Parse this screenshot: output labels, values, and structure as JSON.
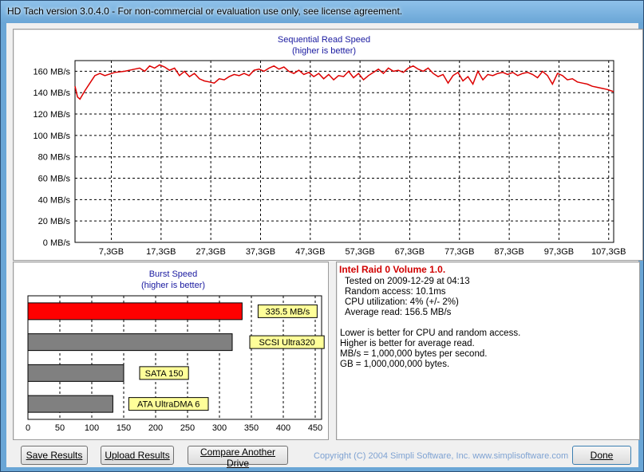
{
  "window": {
    "title": "HD Tach version 3.0.4.0  - For non-commercial or evaluation use only, see license agreement."
  },
  "sequential": {
    "title": "Sequential Read Speed",
    "subtitle": "(higher is better)",
    "y_ticks": [
      "0 MB/s",
      "20 MB/s",
      "40 MB/s",
      "60 MB/s",
      "80 MB/s",
      "100 MB/s",
      "120 MB/s",
      "140 MB/s",
      "160 MB/s"
    ],
    "x_ticks": [
      "7,3GB",
      "17,3GB",
      "27,3GB",
      "37,3GB",
      "47,3GB",
      "57,3GB",
      "67,3GB",
      "77,3GB",
      "87,3GB",
      "97,3GB",
      "107,3GB"
    ]
  },
  "burst": {
    "title": "Burst Speed",
    "subtitle": "(higher is better)",
    "x_ticks": [
      "0",
      "50",
      "100",
      "150",
      "200",
      "250",
      "300",
      "350",
      "400",
      "450"
    ]
  },
  "info": {
    "title": "Intel Raid 0 Volume 1.0.",
    "tested_on": "Tested on 2009-12-29 at 04:13",
    "random_access": "Random access: 10.1ms",
    "cpu": "CPU utilization: 4% (+/- 2%)",
    "avg_read": "Average read: 156.5 MB/s",
    "note1": "Lower is better for CPU and random access.",
    "note2": "Higher is better for average read.",
    "note3": "MB/s = 1,000,000 bytes per second.",
    "note4": "GB = 1,000,000,000 bytes."
  },
  "buttons": {
    "save": "Save Results",
    "upload": "Upload Results",
    "compare": "Compare Another Drive",
    "done": "Done"
  },
  "copyright": "Copyright (C) 2004 Simpli Software, Inc. www.simplisoftware.com",
  "colors": {
    "accent_red": "#dd0000",
    "bar_gray": "#808080",
    "label_yellow": "#ffff99",
    "title_blue": "#1a1aa0"
  },
  "chart_data": [
    {
      "type": "line",
      "title": "Sequential Read Speed",
      "subtitle": "(higher is better)",
      "xlabel": "",
      "ylabel": "",
      "ylim": [
        0,
        170
      ],
      "xlim": [
        0,
        108.3
      ],
      "unit_x": "GB",
      "unit_y": "MB/s",
      "grid": true,
      "series": [
        {
          "x": [
            0,
            0.5,
            1,
            2,
            3,
            4,
            5,
            6,
            8,
            10,
            12,
            13,
            14,
            15,
            16,
            17,
            18,
            19,
            20,
            21,
            22,
            23,
            24,
            25,
            26,
            27,
            28,
            29,
            30,
            31,
            32,
            33,
            34,
            35,
            36,
            37,
            38,
            39,
            40,
            41,
            42,
            43,
            44,
            45,
            46,
            47,
            48,
            49,
            50,
            51,
            52,
            53,
            54,
            55,
            56,
            57,
            58,
            59,
            60,
            61,
            62,
            63,
            64,
            65,
            66,
            67,
            68,
            69,
            70,
            71,
            72,
            73,
            74,
            75,
            76,
            77,
            78,
            79,
            80,
            81,
            82,
            83,
            84,
            85,
            86,
            87,
            88,
            89,
            90,
            91,
            92,
            93,
            94,
            95,
            96,
            97,
            98,
            99,
            100,
            101,
            102,
            103,
            104,
            105,
            106,
            107,
            108.3
          ],
          "y": [
            146,
            136,
            134,
            142,
            149,
            156,
            158,
            156,
            159,
            160,
            162,
            163,
            160,
            165,
            163,
            166,
            164,
            161,
            163,
            156,
            160,
            155,
            158,
            153,
            151,
            150,
            149,
            153,
            152,
            155,
            157,
            156,
            158,
            156,
            161,
            162,
            160,
            163,
            165,
            162,
            164,
            160,
            158,
            161,
            157,
            159,
            155,
            158,
            153,
            157,
            152,
            156,
            155,
            160,
            154,
            158,
            152,
            156,
            159,
            162,
            158,
            163,
            160,
            161,
            159,
            163,
            165,
            162,
            160,
            163,
            158,
            155,
            157,
            149,
            156,
            159,
            151,
            155,
            148,
            160,
            152,
            157,
            156,
            158,
            159,
            157,
            159,
            156,
            158,
            159,
            157,
            154,
            160,
            156,
            148,
            158,
            156,
            152,
            153,
            150,
            149,
            148,
            146,
            145,
            144,
            143,
            141
          ]
        }
      ]
    },
    {
      "type": "bar",
      "title": "Burst Speed",
      "subtitle": "(higher is better)",
      "xlim": [
        0,
        460
      ],
      "categories": [
        "335.5 MB/s",
        "SCSI Ultra320",
        "SATA 150",
        "ATA UltraDMA 6"
      ],
      "values": [
        335.5,
        320,
        150,
        133
      ],
      "colors": [
        "#ff0000",
        "#808080",
        "#808080",
        "#808080"
      ]
    }
  ]
}
